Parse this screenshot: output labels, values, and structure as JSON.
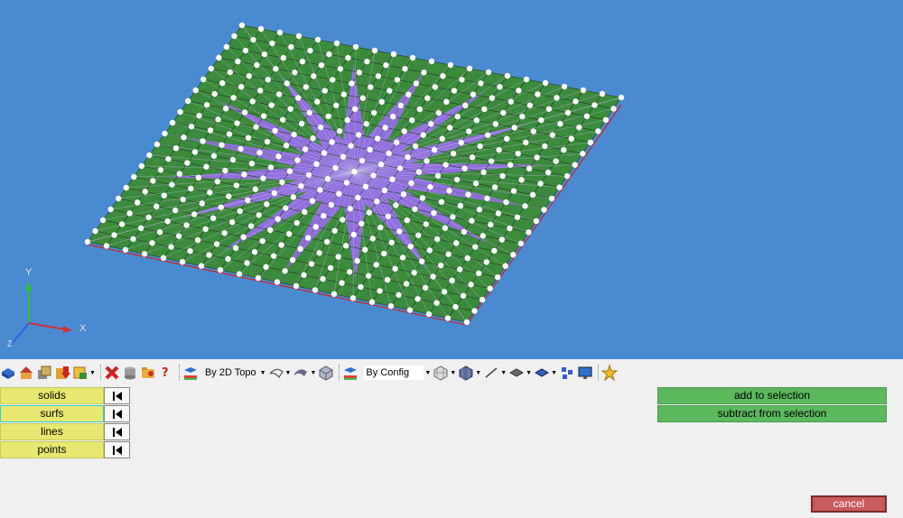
{
  "viewport": {
    "background": "#4a8ad0",
    "axes": {
      "y_label": "Y",
      "x_label": "X",
      "z_label": "Z"
    }
  },
  "toolbar": {
    "topology_select": "By 2D Topo",
    "config_select": "By Config",
    "icons": [
      "solid-icon",
      "house-icon",
      "box-stack-icon",
      "red-down-arrow-icon",
      "yellow-box-icon",
      "delete-icon",
      "cylinder-icon",
      "folder-icon",
      "question-icon",
      "topo-color-icon",
      "surface-icon",
      "shaded-surface-icon",
      "cube-icon",
      "config-icon",
      "mesh-cube-icon",
      "solid-cube-icon",
      "line-icon",
      "plane-icon",
      "blue-plane-icon",
      "nodes-icon",
      "monitor-icon",
      "star-icon"
    ]
  },
  "entity_selector": {
    "items": [
      {
        "label": "solids"
      },
      {
        "label": "surfs"
      },
      {
        "label": "lines"
      },
      {
        "label": "points"
      }
    ]
  },
  "actions": {
    "add": "add to selection",
    "subtract": "subtract from selection",
    "cancel": "cancel"
  },
  "colors": {
    "plate_green": "#3c8a3c",
    "center_purple": "#9b6cf0",
    "nodes": "#ffffff",
    "edge_red": "#d02020",
    "yellow_button": "#e8e870",
    "green_button": "#5cb85c",
    "cancel_button": "#c85a5a"
  }
}
